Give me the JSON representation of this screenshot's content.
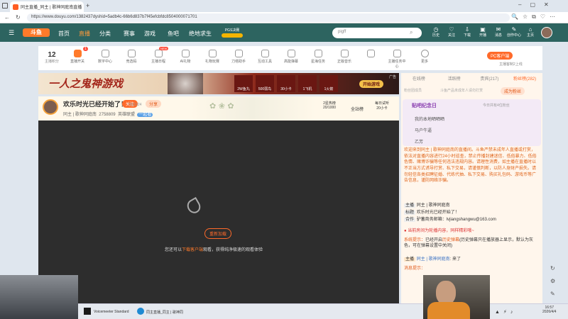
{
  "browser": {
    "tab_title": "同主直播_同主 | 歌神同庭南直播",
    "url": "https://www.douyu.com/1382437dyshid=5adb4c-66b6d837b7f45efcbfdc8504000071701"
  },
  "nav": {
    "logo": "斗鱼",
    "items": [
      "首页",
      "直播",
      "分类",
      "赛事",
      "游戏",
      "鱼吧",
      "绝地求生"
    ],
    "promo": "PGS决赛",
    "search_value": "pigff",
    "icons": [
      "历史",
      "关注",
      "下载",
      "开播",
      "消息",
      "创作中心",
      "主页"
    ]
  },
  "gamebar": {
    "rank": "12",
    "rank_label": "主播积分",
    "items": [
      "直播开关",
      "数字中心",
      "竞选码",
      "主播日程",
      "AI礼物",
      "礼物玩赛",
      "刀塔助手",
      "互动工具",
      "高能弹幕",
      "星海任务",
      "正版音乐",
      "",
      "主播任务中心",
      "更多"
    ],
    "badge": "1",
    "new_badge": "NEW",
    "pc_button": "PC客户端",
    "pc_sub": "主播客制2上线"
  },
  "banner": {
    "text": "一人之鬼神游戏",
    "cta": "开始游戏",
    "ad": "广告",
    "rewards": [
      "2W鱼丸",
      "500弱鸟",
      "30小卡",
      "1飞机",
      "1火箭"
    ]
  },
  "streamer": {
    "title": "欢乐时光已经开始了！",
    "follow": "关注",
    "share": "分享",
    "room_label": "同主",
    "room_sub": "歌神同庭南",
    "room_id": "7051324",
    "fans": "2758809",
    "category": "英雄联盟",
    "tag": "一起看",
    "tier": "2星热榜",
    "tier_value": "20/1000",
    "all": "全站榜",
    "daily": "每日试听",
    "daily_sub": "20小卡"
  },
  "player": {
    "button": "重新加载",
    "hint": "您还可以",
    "hint_link": "下载客户端",
    "hint_tail": "观看，获得纯净极速的观看体验"
  },
  "side": {
    "tabs": [
      "在线榜",
      "活跃榜",
      "贵宾(217)",
      "粉丝榜(282)"
    ],
    "badge_label": "粉丝团成员",
    "badge_text": "斗鱼产品未成年人请勿打赏",
    "badge_btn": "成为粉丝",
    "event_title": "贴吧纪念日",
    "event_sub": "今日共有4位粉丝",
    "event_rows": [
      "我的本地晒晒晒",
      "马户牛逼",
      "乙芳"
    ],
    "welcome": "欢迎来到同主 | 歌神同庭南的直播间。斗鱼严禁未成年人直播或打赏，依法对直播内容进行24小时巡查，禁止传播封建迷信、低俗暴力、低俗色情、赌博诈骗等任何违法违规内容。请理性消费，如主播在直播时以不正当方式诱导打赏、私下交易，请谨慎判断，以防人身财产损失。请勿轻信各类招聘征婚、代练代抽、私下交易、购买礼包码、游戏币等广告信息，谨防网络诈骗。",
    "info": [
      {
        "k": "主播",
        "v": "同主 | 歌神同庭南"
      },
      {
        "k": "标题",
        "v": "欢乐时光已经开始了！"
      },
      {
        "k": "合作",
        "v": "驴蓄商务邮箱：lvjiangshangwu@163.com"
      }
    ],
    "notice": "当前房间为轮播内容，同样精彩哦~",
    "sys_label": "系统提示：",
    "sys_text": "已经开启",
    "sys_link": "历史弹幕",
    "sys_tail": "(历史弹幕只在播放器上显示，默认为灰色，可在弹幕设置中关闭)",
    "chat_user": "同主 | 歌神同庭南",
    "chat_text": "来了",
    "tip_label": "消息提示："
  },
  "taskbar": {
    "apps": [
      "Voicemeeter Standard",
      "同主直播_同主 | 歌神同"
    ],
    "time": "16:57",
    "date": "2026/4/4"
  }
}
